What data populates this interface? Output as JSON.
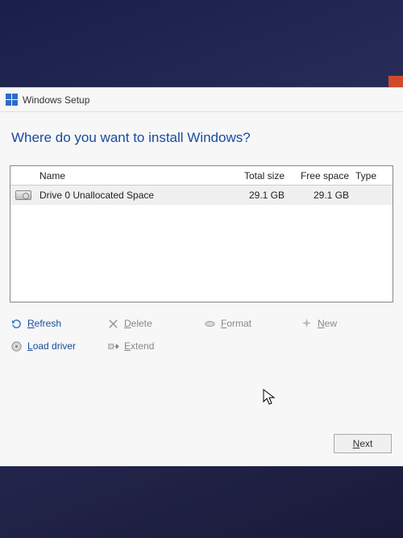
{
  "window": {
    "title": "Windows Setup"
  },
  "heading": "Where do you want to install Windows?",
  "columns": {
    "name": "Name",
    "total": "Total size",
    "free": "Free space",
    "type": "Type"
  },
  "drives": [
    {
      "icon": "hdd-icon",
      "name": "Drive 0 Unallocated Space",
      "total": "29.1 GB",
      "free": "29.1 GB",
      "type": ""
    }
  ],
  "actions": {
    "refresh": {
      "label": "Refresh",
      "enabled": true
    },
    "delete": {
      "label": "Delete",
      "enabled": false
    },
    "format": {
      "label": "Format",
      "enabled": false
    },
    "new": {
      "label": "New",
      "enabled": false
    },
    "loadDriver": {
      "label": "Load driver",
      "enabled": true
    },
    "extend": {
      "label": "Extend",
      "enabled": false
    }
  },
  "next": {
    "label": "Next"
  }
}
